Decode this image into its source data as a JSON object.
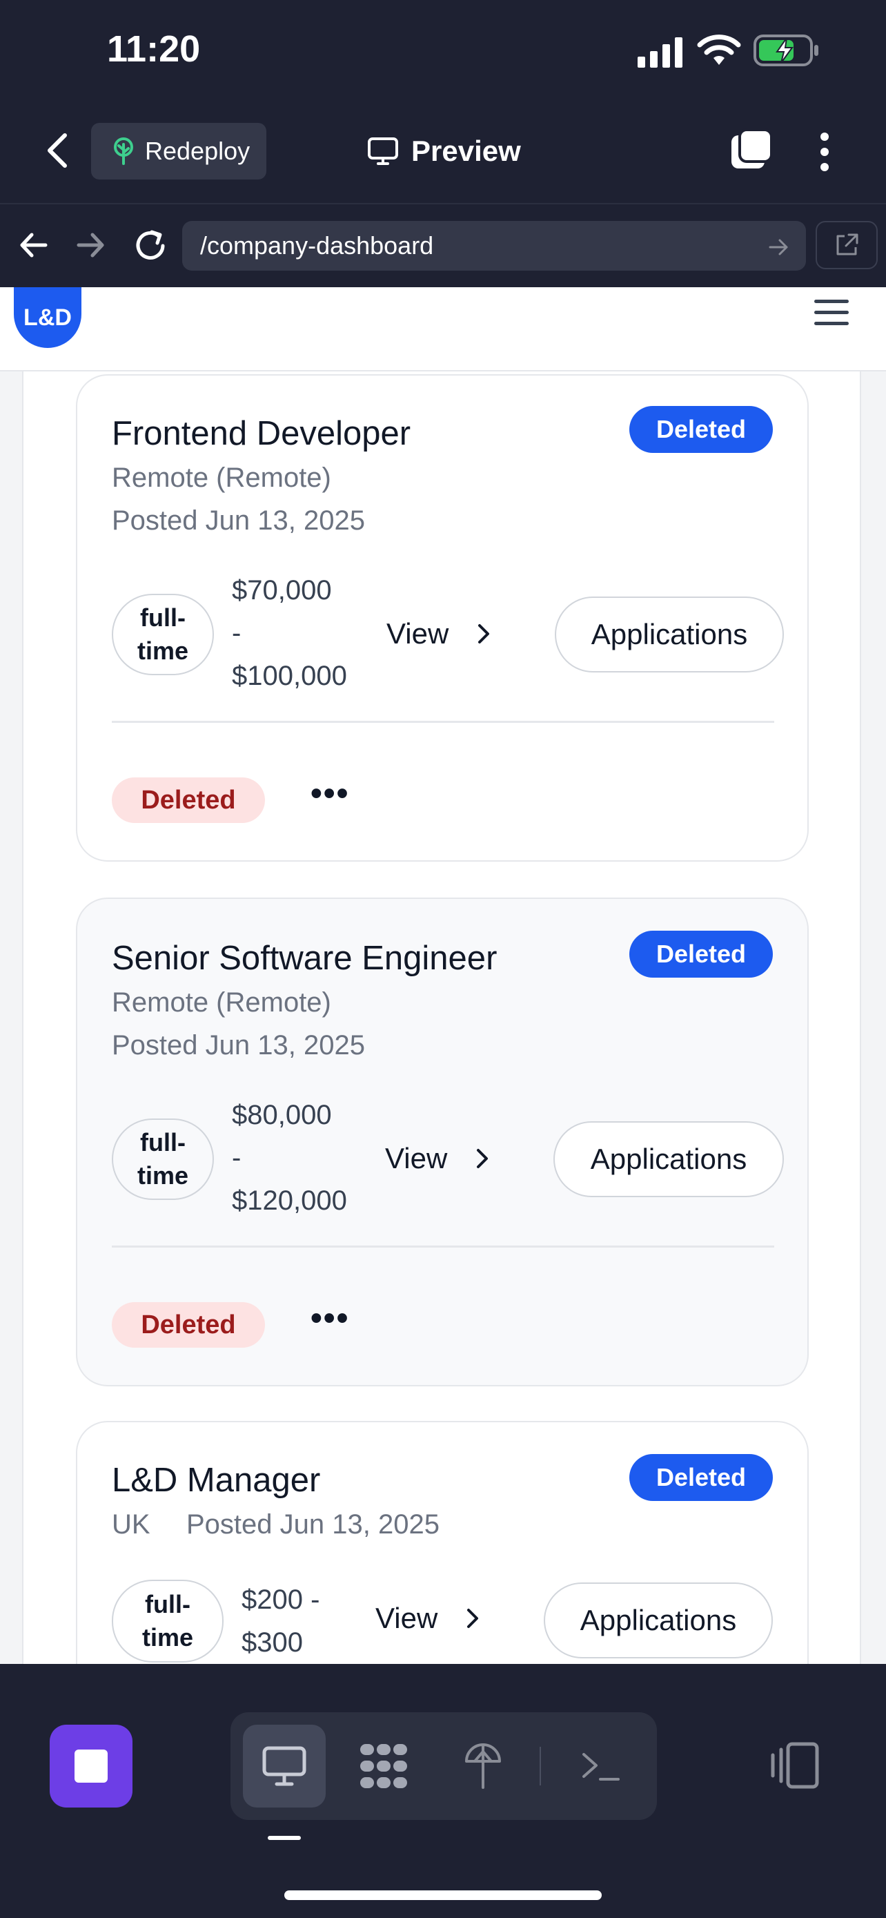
{
  "status_bar": {
    "time": "11:20"
  },
  "toolbar": {
    "redeploy_label": "Redeploy",
    "preview_label": "Preview"
  },
  "browser": {
    "url": "/company-dashboard"
  },
  "site": {
    "logo_text": "L&D"
  },
  "jobs": [
    {
      "title": "Frontend Developer",
      "badge": "Deleted",
      "location": "Remote (Remote)",
      "posted": "Posted Jun 13, 2025",
      "type_line1": "full-",
      "type_line2": "time",
      "salary_line1": "$70,000",
      "salary_line2": "-",
      "salary_line3": "$100,000",
      "view_label": "View",
      "applications_label": "Applications",
      "status": "Deleted",
      "more": "•••"
    },
    {
      "title": "Senior Software Engineer",
      "badge": "Deleted",
      "location": "Remote (Remote)",
      "posted": "Posted Jun 13, 2025",
      "type_line1": "full-",
      "type_line2": "time",
      "salary_line1": "$80,000",
      "salary_line2": "-",
      "salary_line3": "$120,000",
      "view_label": "View",
      "applications_label": "Applications",
      "status": "Deleted",
      "more": "•••"
    },
    {
      "title": "L&D Manager",
      "badge": "Deleted",
      "location": "UK",
      "posted": "Posted Jun 13, 2025",
      "type_line1": "full-",
      "type_line2": "time",
      "salary_line1": "$200 -",
      "salary_line2": "$300",
      "view_label": "View",
      "applications_label": "Applications"
    }
  ],
  "colors": {
    "brand": "#1d5bef",
    "danger_bg": "#fde2e2",
    "danger_text": "#9b1c1c",
    "stop_button": "#6d3ee6"
  },
  "icons": [
    "back-chevron-icon",
    "tree-icon",
    "monitor-icon",
    "tabs-icon",
    "more-vertical-icon",
    "arrow-left-icon",
    "arrow-right-icon",
    "reload-icon",
    "external-link-icon",
    "hamburger-icon",
    "chevron-right-icon",
    "stop-icon",
    "desktop-icon",
    "network-icon",
    "deploy-icon",
    "terminal-icon",
    "device-toggle-icon"
  ]
}
